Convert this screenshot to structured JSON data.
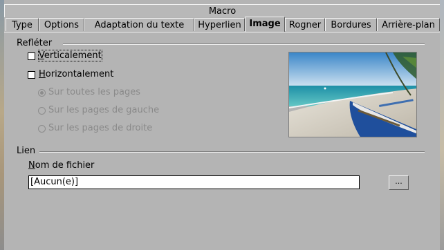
{
  "dialog": {
    "macro_tab": "Macro"
  },
  "tabs": [
    {
      "label": "Type"
    },
    {
      "label": "Options"
    },
    {
      "label": "Adaptation du texte"
    },
    {
      "label": "Hyperlien"
    },
    {
      "label": "Image"
    },
    {
      "label": "Rogner"
    },
    {
      "label": "Bordures"
    },
    {
      "label": "Arrière-plan"
    }
  ],
  "mirror": {
    "section_label": "Refléter",
    "vertical": {
      "label_underlined": "V",
      "label_rest": "erticalement",
      "checked": false
    },
    "horizontal": {
      "label_underlined": "H",
      "label_rest": "orizontalement",
      "checked": false
    },
    "options": [
      {
        "label": "Sur toutes les pages",
        "selected": true
      },
      {
        "label": "Sur les pages de gauche",
        "selected": false
      },
      {
        "label": "Sur les pages de droite",
        "selected": false
      }
    ]
  },
  "link": {
    "section_label": "Lien",
    "filename_label_underlined": "N",
    "filename_label_rest": "om de fichier",
    "filename_value": "[Aucun(e)]",
    "browse_label": "..."
  },
  "preview": {
    "icon": "beach-boat-image"
  }
}
